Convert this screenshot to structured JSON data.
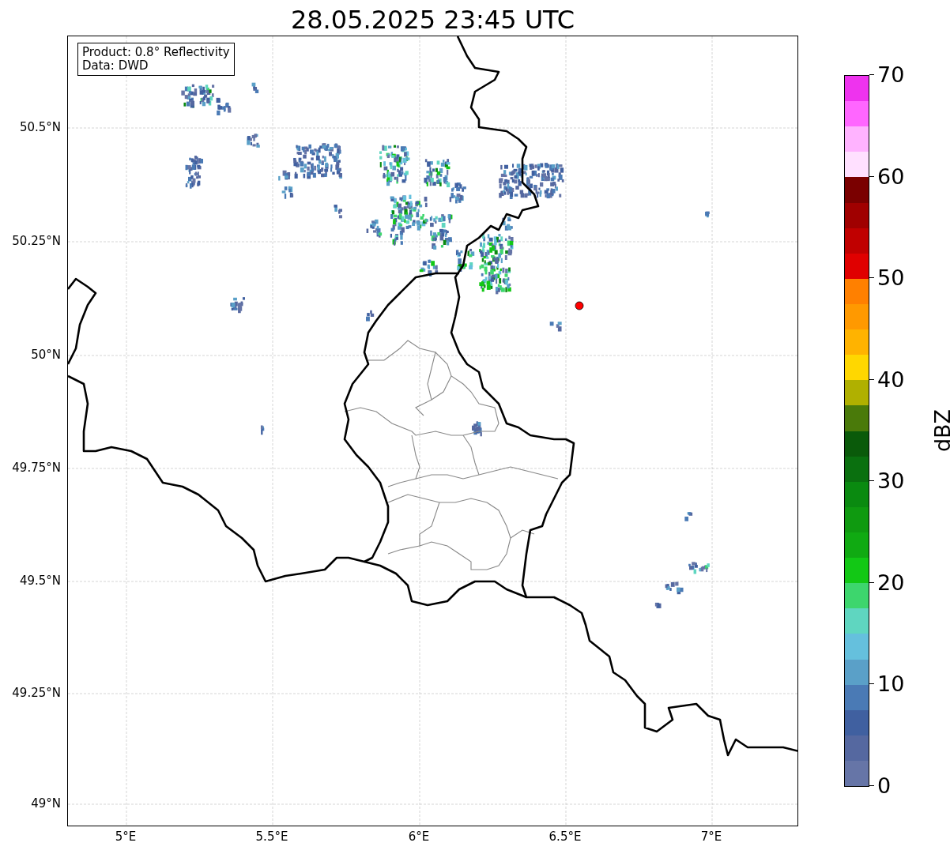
{
  "title": "28.05.2025 23:45 UTC",
  "legend": [
    "Product: 0.8° Reflectivity",
    "Data: DWD"
  ],
  "x_ticks": [
    "5°E",
    "5.5°E",
    "6°E",
    "6.5°E",
    "7°E"
  ],
  "y_ticks": [
    "50.5°N",
    "50.25°N",
    "50°N",
    "49.75°N",
    "49.5°N",
    "49.25°N",
    "49°N"
  ],
  "colorbar": {
    "label": "dBZ",
    "ticks": [
      "70",
      "60",
      "50",
      "40",
      "30",
      "20",
      "10",
      "0"
    ],
    "bands": [
      {
        "color": "#ee33ee"
      },
      {
        "color": "#ff66ff"
      },
      {
        "color": "#ffb3ff"
      },
      {
        "color": "#ffe0ff"
      },
      {
        "color": "#7a0000"
      },
      {
        "color": "#a00000"
      },
      {
        "color": "#c00000"
      },
      {
        "color": "#e00000"
      },
      {
        "color": "#ff8000"
      },
      {
        "color": "#ff9900"
      },
      {
        "color": "#ffb300"
      },
      {
        "color": "#ffd700"
      },
      {
        "color": "#b0b000"
      },
      {
        "color": "#4a7a0a"
      },
      {
        "color": "#0a5a0a"
      },
      {
        "color": "#0a700f"
      },
      {
        "color": "#0a8a10"
      },
      {
        "color": "#0f9a10"
      },
      {
        "color": "#10aa12"
      },
      {
        "color": "#12c815"
      },
      {
        "color": "#3dd66d"
      },
      {
        "color": "#5fd6c0"
      },
      {
        "color": "#65c0dd"
      },
      {
        "color": "#5aa0c8"
      },
      {
        "color": "#4a7ab5"
      },
      {
        "color": "#4060a0"
      },
      {
        "color": "#5568a0"
      },
      {
        "color": "#6675a7"
      }
    ]
  }
}
